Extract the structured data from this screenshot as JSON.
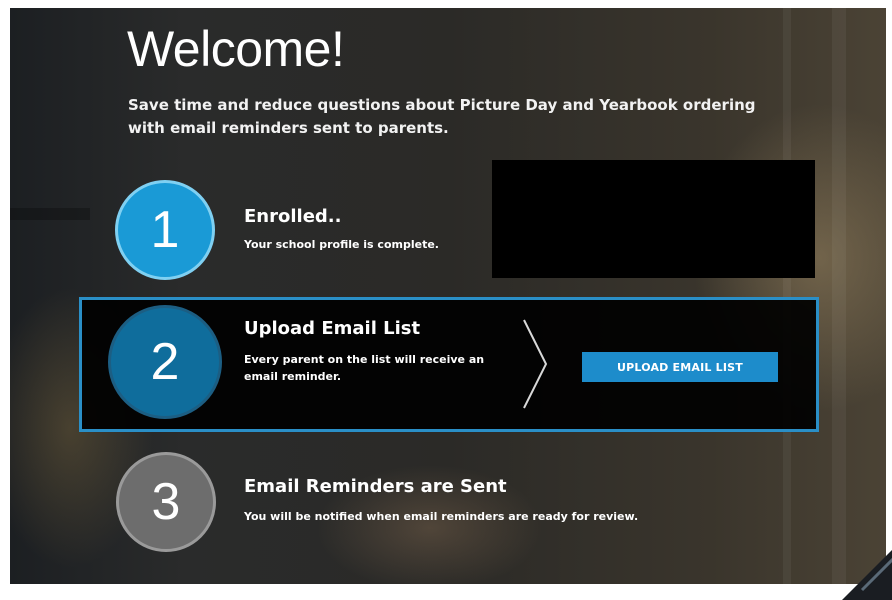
{
  "header": {
    "title": "Welcome!",
    "subtitle": "Save time and reduce questions about Picture Day and Yearbook ordering with email reminders sent to parents."
  },
  "steps": [
    {
      "number": "1",
      "title": "Enrolled..",
      "description": "Your school profile is complete.",
      "color": "#1a9ad6"
    },
    {
      "number": "2",
      "title": "Upload Email List",
      "description": "Every parent on the list will receive an email reminder.",
      "button_label": "UPLOAD EMAIL LIST",
      "color": "#0f6d9c"
    },
    {
      "number": "3",
      "title": "Email Reminders are Sent",
      "description": "You will be notified when email reminders are ready for review.",
      "color": "#6d6d6d"
    }
  ],
  "accent_color": "#2a8fc7"
}
